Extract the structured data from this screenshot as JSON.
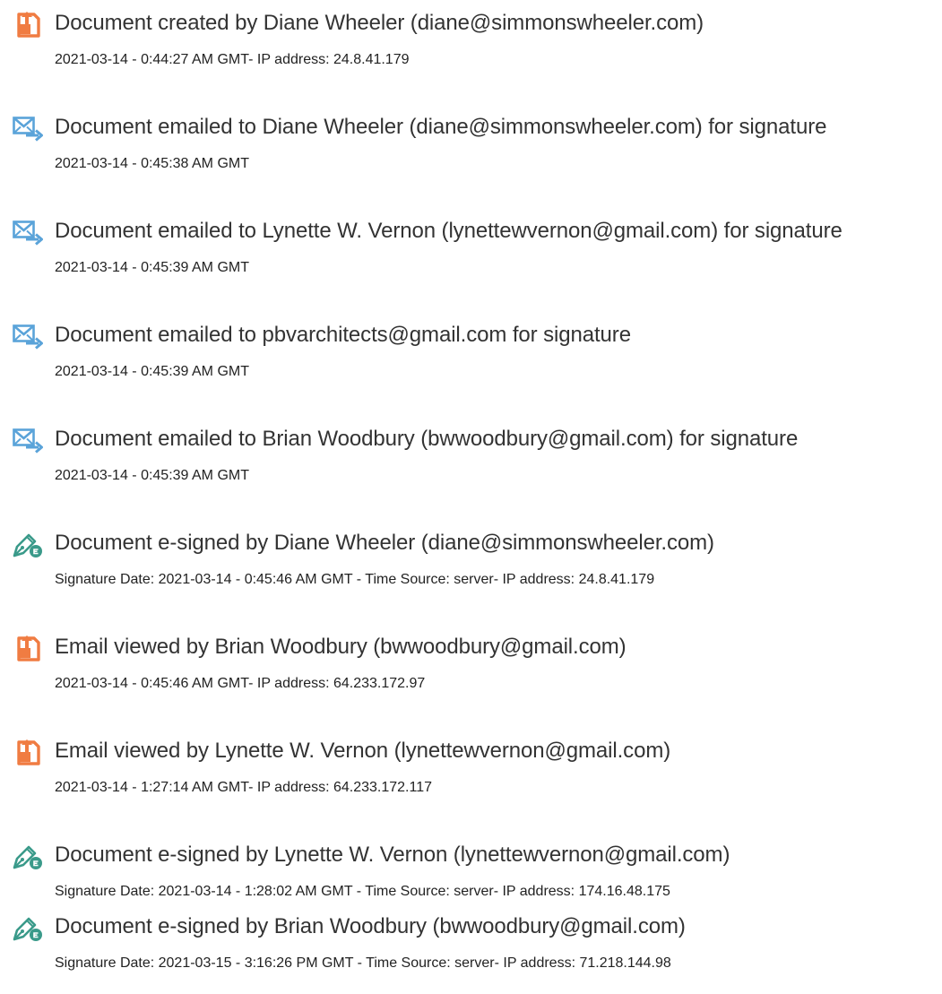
{
  "colors": {
    "created_icon": "#f07c42",
    "email_icon": "#5aa3d9",
    "signed_icon": "#3a9a8a",
    "title_text": "#333333",
    "detail_text": "#222222"
  },
  "events": [
    {
      "icon": "document-created-icon",
      "title": "Document created by Diane Wheeler (diane@simmonswheeler.com)",
      "detail": "2021-03-14 - 0:44:27 AM GMT- IP address: 24.8.41.179"
    },
    {
      "icon": "email-sent-icon",
      "title": "Document emailed to Diane Wheeler (diane@simmonswheeler.com) for signature",
      "detail": "2021-03-14 - 0:45:38 AM GMT"
    },
    {
      "icon": "email-sent-icon",
      "title": "Document emailed to Lynette W. Vernon (lynettewvernon@gmail.com) for signature",
      "detail": "2021-03-14 - 0:45:39 AM GMT"
    },
    {
      "icon": "email-sent-icon",
      "title": "Document emailed to pbvarchitects@gmail.com for signature",
      "detail": "2021-03-14 - 0:45:39 AM GMT"
    },
    {
      "icon": "email-sent-icon",
      "title": "Document emailed to Brian Woodbury (bwwoodbury@gmail.com) for signature",
      "detail": "2021-03-14 - 0:45:39 AM GMT"
    },
    {
      "icon": "esign-pen-icon",
      "title": "Document e-signed by Diane Wheeler (diane@simmonswheeler.com)",
      "detail": "Signature Date: 2021-03-14 - 0:45:46 AM GMT - Time Source: server- IP address: 24.8.41.179"
    },
    {
      "icon": "document-viewed-icon",
      "title": "Email viewed by Brian Woodbury (bwwoodbury@gmail.com)",
      "detail": "2021-03-14 - 0:45:46 AM GMT- IP address: 64.233.172.97"
    },
    {
      "icon": "document-viewed-icon",
      "title": "Email viewed by Lynette W. Vernon (lynettewvernon@gmail.com)",
      "detail": "2021-03-14 - 1:27:14 AM GMT- IP address: 64.233.172.117"
    },
    {
      "icon": "esign-pen-icon",
      "title": "Document e-signed by Lynette W. Vernon (lynettewvernon@gmail.com)",
      "detail": "Signature Date: 2021-03-14 - 1:28:02 AM GMT - Time Source: server- IP address: 174.16.48.175"
    },
    {
      "icon": "esign-pen-icon",
      "title": "Document e-signed by Brian Woodbury (bwwoodbury@gmail.com)",
      "detail": "Signature Date: 2021-03-15 - 3:16:26 PM GMT - Time Source: server- IP address: 71.218.144.98"
    }
  ]
}
